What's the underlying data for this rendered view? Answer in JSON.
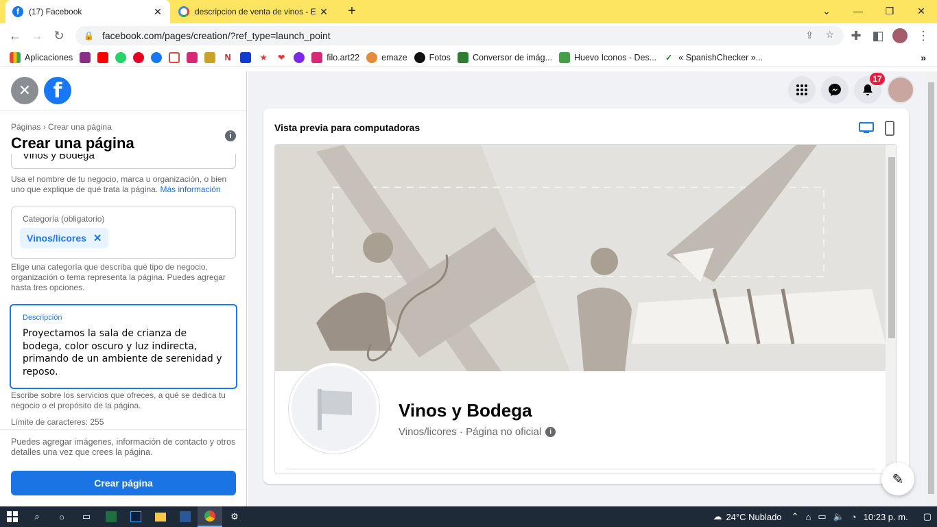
{
  "browser": {
    "tabs": [
      {
        "title": "(17) Facebook",
        "active": true
      },
      {
        "title": "descripcion de venta de vinos - E",
        "active": false
      }
    ],
    "url": "facebook.com/pages/creation/?ref_type=launch_point",
    "bookmarks": [
      "Aplicaciones",
      "filo.art22",
      "emaze",
      "Fotos",
      "Conversor de imág...",
      "Huevo Iconos - Des...",
      "« SpanishChecker »..."
    ]
  },
  "left": {
    "breadcrumb": "Páginas › Crear una página",
    "title": "Crear una página",
    "name_value": "Vinos y Bodega",
    "name_helper": "Usa el nombre de tu negocio, marca u organización, o bien uno que explique de qué trata la página.",
    "name_helper_link": "Más información",
    "category_label": "Categoría (obligatorio)",
    "category_chip": "Vinos/licores",
    "category_helper": "Elige una categoría que describa qué tipo de negocio, organización o tema representa la página. Puedes agregar hasta tres opciones.",
    "description_label": "Descripción",
    "description_value": "Proyectamos la sala de crianza de bodega, color oscuro y luz indirecta, primando de un ambiente de serenidad y reposo.",
    "description_helper": "Escribe sobre los servicios que ofreces, a qué se dedica tu negocio o el propósito de la página.",
    "char_limit": "Límite de caracteres: 255",
    "footer_note": "Puedes agregar imágenes, información de contacto y otros detalles una vez que crees la página.",
    "create_button": "Crear página"
  },
  "header": {
    "notifications_badge": "17"
  },
  "preview": {
    "title": "Vista previa para computadoras",
    "page_name": "Vinos y Bodega",
    "page_subtitle": "Vinos/licores · Página no oficial"
  },
  "taskbar": {
    "weather": "24°C  Nublado",
    "time": "10:23 p. m."
  },
  "colors": {
    "facebook_blue": "#1877f2",
    "chrome_yellow": "#fde562",
    "button_blue": "#1b74e4"
  }
}
